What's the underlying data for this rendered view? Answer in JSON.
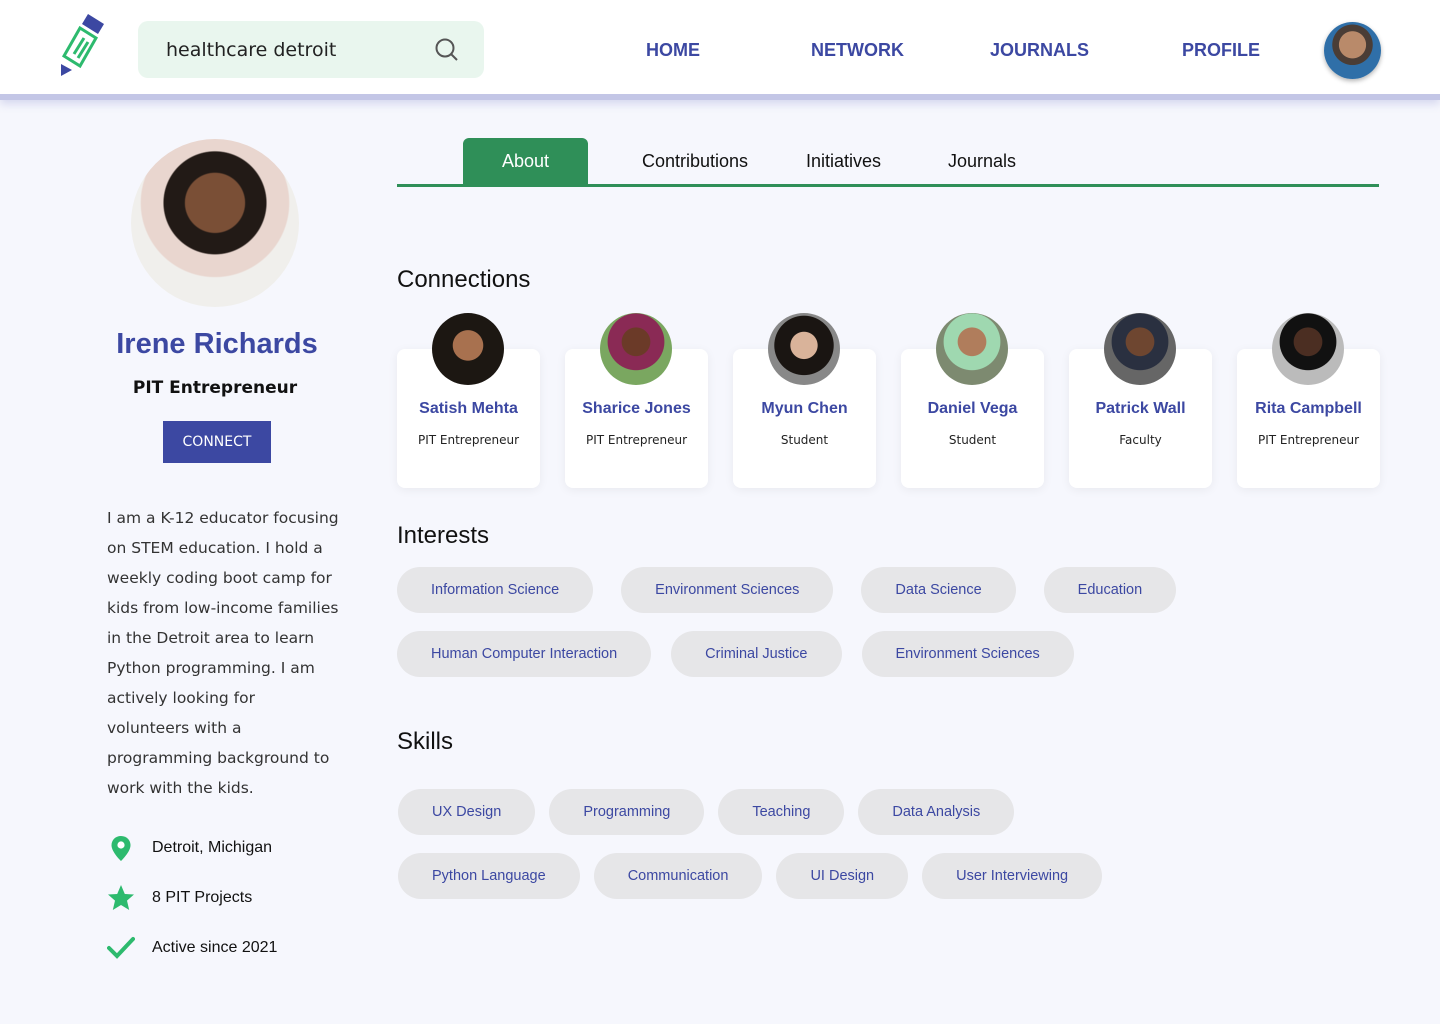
{
  "header": {
    "search_value": "healthcare detroit",
    "search_icon": "search-icon",
    "nav": [
      "HOME",
      "NETWORK",
      "JOURNALS",
      "PROFILE"
    ]
  },
  "profile": {
    "name": "Irene Richards",
    "role": "PIT Entrepreneur",
    "connect_label": "CONNECT",
    "bio": "I am a K-12 educator focusing on STEM education. I hold a weekly coding boot camp for kids from low-income families in the Detroit area to learn Python programming. I am actively looking for volunteers with a programming background to work with the kids.",
    "location": "Detroit,  Michigan",
    "projects": "8 PIT Projects",
    "active": "Active since 2021"
  },
  "tabs": [
    "About",
    "Contributions",
    "Initiatives",
    "Journals"
  ],
  "sections": {
    "connections": "Connections",
    "interests": "Interests",
    "skills": "Skills"
  },
  "connections": [
    {
      "name": "Satish Mehta",
      "role": "PIT Entrepreneur"
    },
    {
      "name": "Sharice Jones",
      "role": "PIT Entrepreneur"
    },
    {
      "name": "Myun Chen",
      "role": "Student"
    },
    {
      "name": "Daniel Vega",
      "role": "Student"
    },
    {
      "name": "Patrick Wall",
      "role": "Faculty"
    },
    {
      "name": "Rita Campbell",
      "role": "PIT Entrepreneur"
    }
  ],
  "interests": [
    [
      "Information Science",
      "Environment Sciences",
      "Data Science",
      "Education"
    ],
    [
      "Human Computer Interaction",
      "Criminal Justice",
      "Environment Sciences"
    ]
  ],
  "skills": [
    [
      "UX Design",
      "Programming",
      "Teaching",
      "Data Analysis"
    ],
    [
      "Python Language",
      "Communication",
      "UI Design",
      "User Interviewing"
    ]
  ],
  "colors": {
    "primary": "#3c48a2",
    "accent_green": "#2f8f58",
    "icon_green": "#2dba6e",
    "search_bg": "#e9f6ee"
  }
}
